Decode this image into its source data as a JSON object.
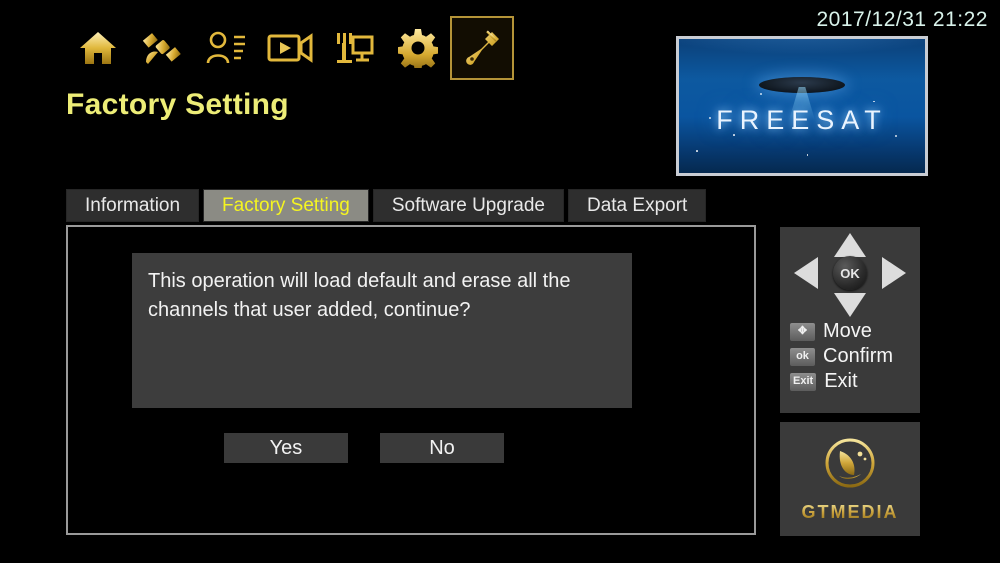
{
  "statusbar": {
    "datetime": "2017/12/31  21:22"
  },
  "navbar": {
    "items": [
      {
        "icon": "home-icon",
        "name": "nav-home",
        "selected": false
      },
      {
        "icon": "satellite-icon",
        "name": "nav-satellite",
        "selected": false
      },
      {
        "icon": "user-list-icon",
        "name": "nav-channel-list",
        "selected": false
      },
      {
        "icon": "video-camera-icon",
        "name": "nav-media",
        "selected": false
      },
      {
        "icon": "monitor-antenna-icon",
        "name": "nav-display",
        "selected": false
      },
      {
        "icon": "gear-icon",
        "name": "nav-settings",
        "selected": false
      },
      {
        "icon": "wrench-icon",
        "name": "nav-tools",
        "selected": true
      }
    ]
  },
  "page": {
    "title": "Factory Setting"
  },
  "preview": {
    "brand": "FREESAT"
  },
  "tabs": [
    {
      "label": "Information",
      "active": false
    },
    {
      "label": "Factory Setting",
      "active": true
    },
    {
      "label": "Software Upgrade",
      "active": false
    },
    {
      "label": "Data Export",
      "active": false
    }
  ],
  "dialog": {
    "message": "This operation will load default and erase all the channels that user added, continue?",
    "buttons": [
      {
        "label": "Yes"
      },
      {
        "label": "No"
      }
    ]
  },
  "help": {
    "rows": [
      {
        "key": "✥",
        "label": "Move"
      },
      {
        "key": "ok",
        "label": "Confirm"
      },
      {
        "key": "Exit",
        "label": "Exit"
      }
    ],
    "ok_label": "OK"
  },
  "brand": {
    "name": "GTMEDIA"
  },
  "colors": {
    "background": "#000000",
    "gold": "#d8b238",
    "title_yellow": "#eded77",
    "tab_active_bg": "#8b8b84",
    "tab_active_text": "#f5f520",
    "tab_bg": "#2e2e2e",
    "panel_border": "#9a9a9a",
    "msgbox_bg": "#3d3d3d",
    "clock_text": "#d8f2ea"
  }
}
